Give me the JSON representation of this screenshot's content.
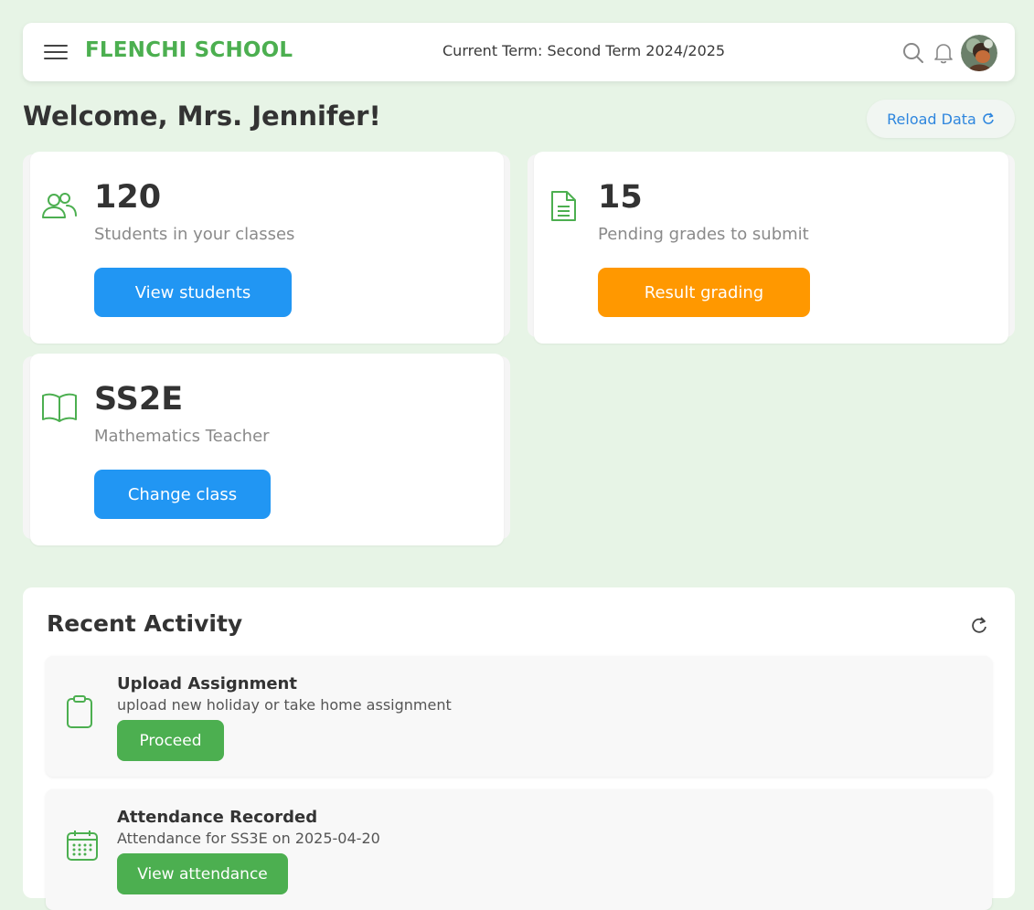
{
  "header": {
    "brand": "FLENCHI SCHOOL",
    "current_term": "Current Term: Second Term 2024/2025",
    "icons": [
      "menu-icon",
      "search-icon",
      "bell-icon",
      "avatar"
    ]
  },
  "welcome": {
    "title": "Welcome, Mrs. Jennifer!",
    "reload_label": "Reload Data"
  },
  "stats": [
    {
      "value": "120",
      "description": "Students in your classes",
      "button": "View students",
      "icon": "users-icon",
      "button_color": "#2196f3"
    },
    {
      "value": "15",
      "description": "Pending grades to submit",
      "button": "Result grading",
      "icon": "document-icon",
      "button_color": "#ff9800"
    },
    {
      "value": "SS2E",
      "description": "Mathematics Teacher",
      "button": "Change class",
      "icon": "book-icon",
      "button_color": "#2196f3"
    }
  ],
  "activity": {
    "title": "Recent Activity",
    "items": [
      {
        "title": "Upload Assignment",
        "description": "upload new holiday or take home assignment",
        "button": "Proceed",
        "icon": "clipboard-icon"
      },
      {
        "title": "Attendance Recorded",
        "description": "Attendance for SS3E on 2025-04-20",
        "button": "View attendance",
        "icon": "calendar-icon"
      }
    ]
  },
  "colors": {
    "brand_green": "#4caf50",
    "background": "#e7f4e6",
    "primary_blue": "#2196f3",
    "accent_orange": "#ff9800",
    "link_blue": "#2e86de"
  }
}
